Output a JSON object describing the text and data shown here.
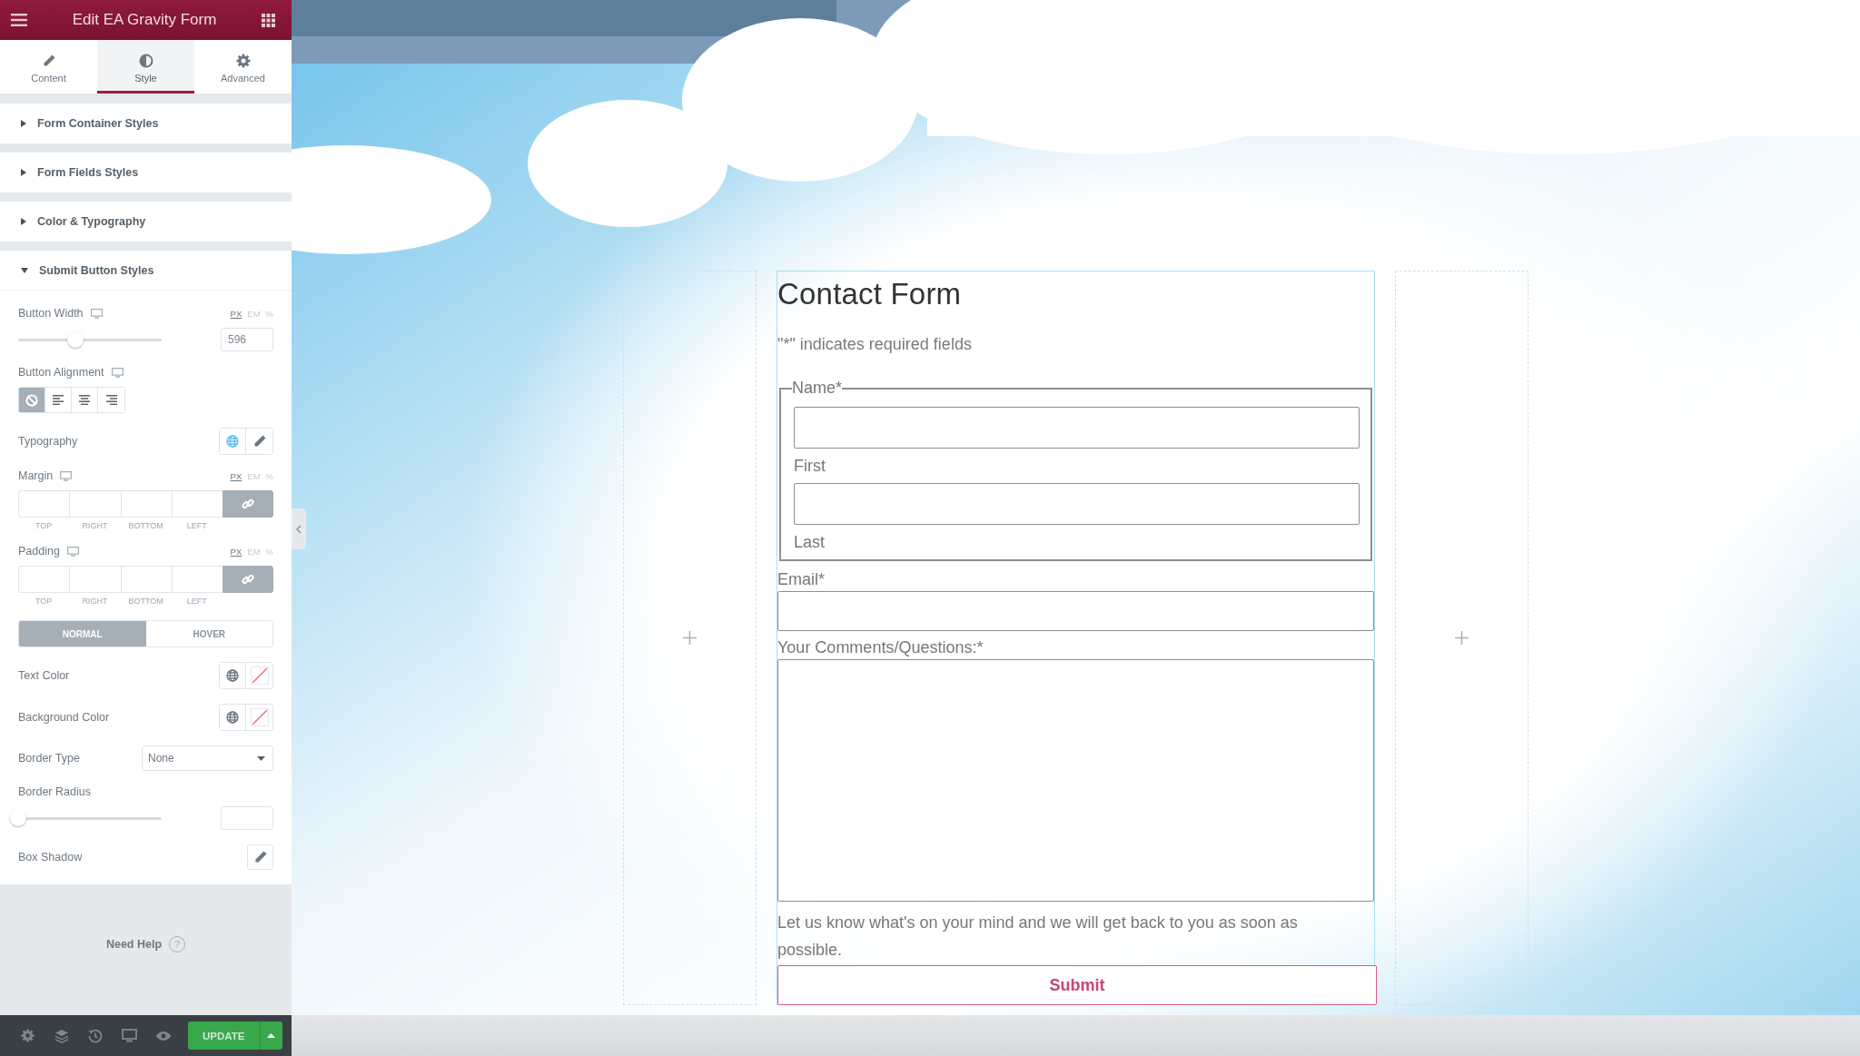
{
  "header": {
    "title": "Edit EA Gravity Form"
  },
  "tabs": [
    {
      "label": "Content",
      "selected": false
    },
    {
      "label": "Style",
      "selected": true
    },
    {
      "label": "Advanced",
      "selected": false
    }
  ],
  "sections": [
    {
      "title": "Form Container Styles",
      "expanded": false
    },
    {
      "title": "Form Fields Styles",
      "expanded": false
    },
    {
      "title": "Color & Typography",
      "expanded": false
    },
    {
      "title": "Submit Button Styles",
      "expanded": true,
      "controls": [
        {
          "kind": "slider",
          "label": "Button Width",
          "responsive": true,
          "units": [
            {
              "label": "PX",
              "selected": true
            },
            {
              "label": "EM",
              "selected": false
            },
            {
              "label": "%",
              "selected": false
            }
          ],
          "level": 0.4,
          "value": "596"
        },
        {
          "kind": "choices",
          "label": "Button Alignment",
          "responsive": true,
          "options": [
            {
              "selected": true
            },
            {
              "selected": false
            },
            {
              "selected": false
            },
            {
              "selected": false
            }
          ]
        },
        {
          "kind": "typography",
          "label": "Typography"
        },
        {
          "kind": "dimensions",
          "label": "Margin",
          "responsive": true,
          "units": [
            {
              "label": "PX",
              "selected": true
            },
            {
              "label": "EM",
              "selected": false
            },
            {
              "label": "%",
              "selected": false
            }
          ],
          "sides": [
            "TOP",
            "RIGHT",
            "BOTTOM",
            "LEFT"
          ],
          "linked": true
        },
        {
          "kind": "dimensions",
          "label": "Padding",
          "responsive": true,
          "units": [
            {
              "label": "PX",
              "selected": true
            },
            {
              "label": "EM",
              "selected": false
            },
            {
              "label": "%",
              "selected": false
            }
          ],
          "sides": [
            "TOP",
            "RIGHT",
            "BOTTOM",
            "LEFT"
          ],
          "linked": true
        },
        {
          "kind": "state_tabs",
          "tabs": [
            {
              "label": "NORMAL",
              "selected": true
            },
            {
              "label": "HOVER",
              "selected": false
            }
          ]
        },
        {
          "kind": "color",
          "label": "Text Color"
        },
        {
          "kind": "color",
          "label": "Background Color"
        },
        {
          "kind": "select",
          "label": "Border Type",
          "value": "None"
        },
        {
          "kind": "slider",
          "label": "Border Radius",
          "responsive": false,
          "level": 0
        },
        {
          "kind": "shadow",
          "label": "Box Shadow"
        }
      ]
    }
  ],
  "help": {
    "label": "Need Help",
    "icon": "?"
  },
  "footer": {
    "update": "UPDATE"
  },
  "form": {
    "title": "Contact Form",
    "note": "\"*\" indicates required fields",
    "fields": [
      {
        "kind": "name",
        "label": "Name*",
        "parts": [
          "First",
          "Last"
        ]
      },
      {
        "kind": "text",
        "label": "Email*"
      },
      {
        "kind": "textarea",
        "label": "Your Comments/Questions:*",
        "description": "Let us know what's on your mind and we will get back to you as soon as possible."
      }
    ],
    "submit": "Submit"
  }
}
